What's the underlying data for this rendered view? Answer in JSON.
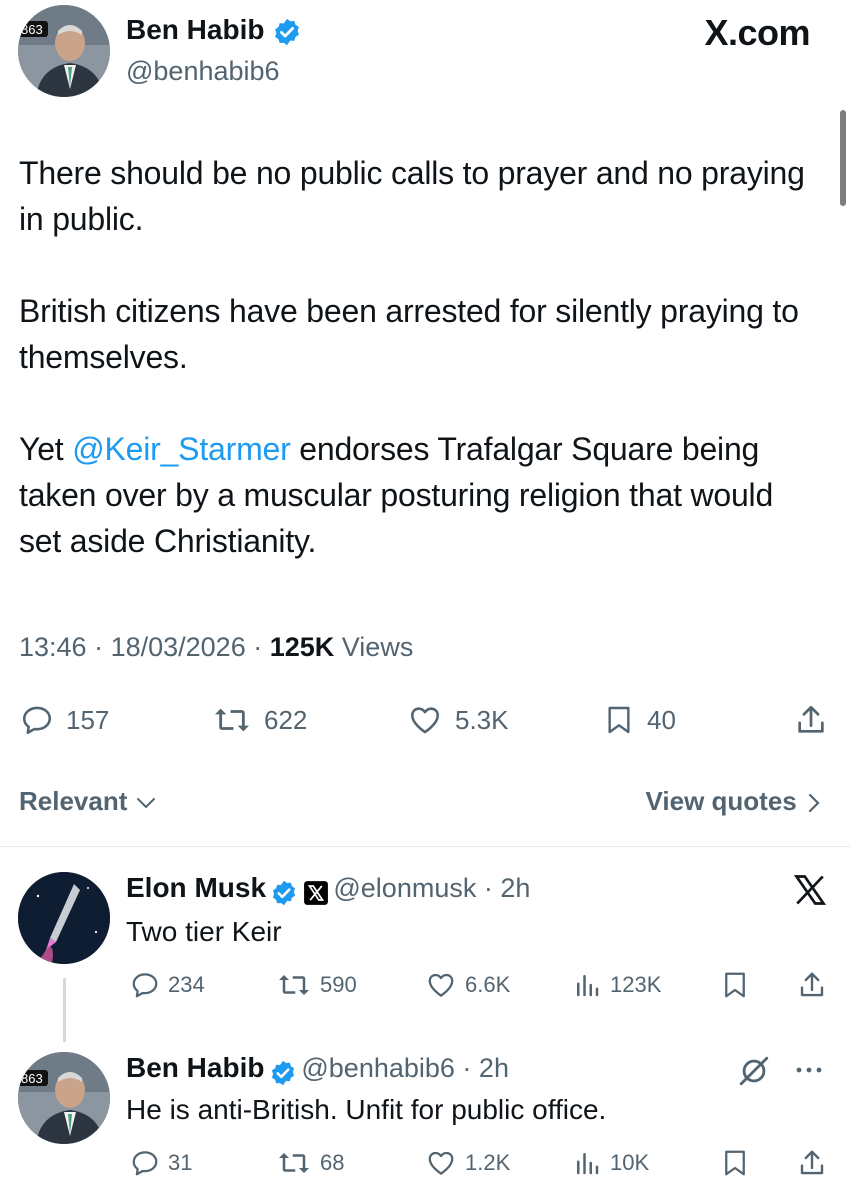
{
  "site": {
    "logo_text": "X.com"
  },
  "tweet": {
    "author_name": "Ben Habib",
    "author_handle": "@benhabib6",
    "avatar_badge": "863",
    "paragraphs": [
      "There should be no public calls to prayer and no praying in public.",
      "British citizens have been arrested for silently praying to themselves."
    ],
    "p3_prefix": "Yet ",
    "p3_mention": "@Keir_Starmer",
    "p3_suffix": " endorses Trafalgar Square being taken over by a muscular posturing religion that would set aside Christianity.",
    "time": "13:46",
    "date": "18/03/2026",
    "views_count": "125K",
    "views_label": "Views",
    "stats": {
      "replies": "157",
      "reposts": "622",
      "likes": "5.3K",
      "bookmarks": "40"
    }
  },
  "replies_bar": {
    "sort_label": "Relevant",
    "view_quotes_label": "View quotes"
  },
  "replies": [
    {
      "name": "Elon Musk",
      "handle": "@elonmusk",
      "time": "2h",
      "text": "Two tier Keir",
      "stats": {
        "replies": "234",
        "reposts": "590",
        "likes": "6.6K",
        "views": "123K"
      }
    },
    {
      "name": "Ben Habib",
      "handle": "@benhabib6",
      "time": "2h",
      "text": "He is anti-British. Unfit for public office.",
      "avatar_badge": "863",
      "stats": {
        "replies": "31",
        "reposts": "68",
        "likes": "1.2K",
        "views": "10K"
      }
    }
  ],
  "colors": {
    "accent": "#1d9bf0",
    "text": "#0f1419",
    "muted": "#536471"
  }
}
